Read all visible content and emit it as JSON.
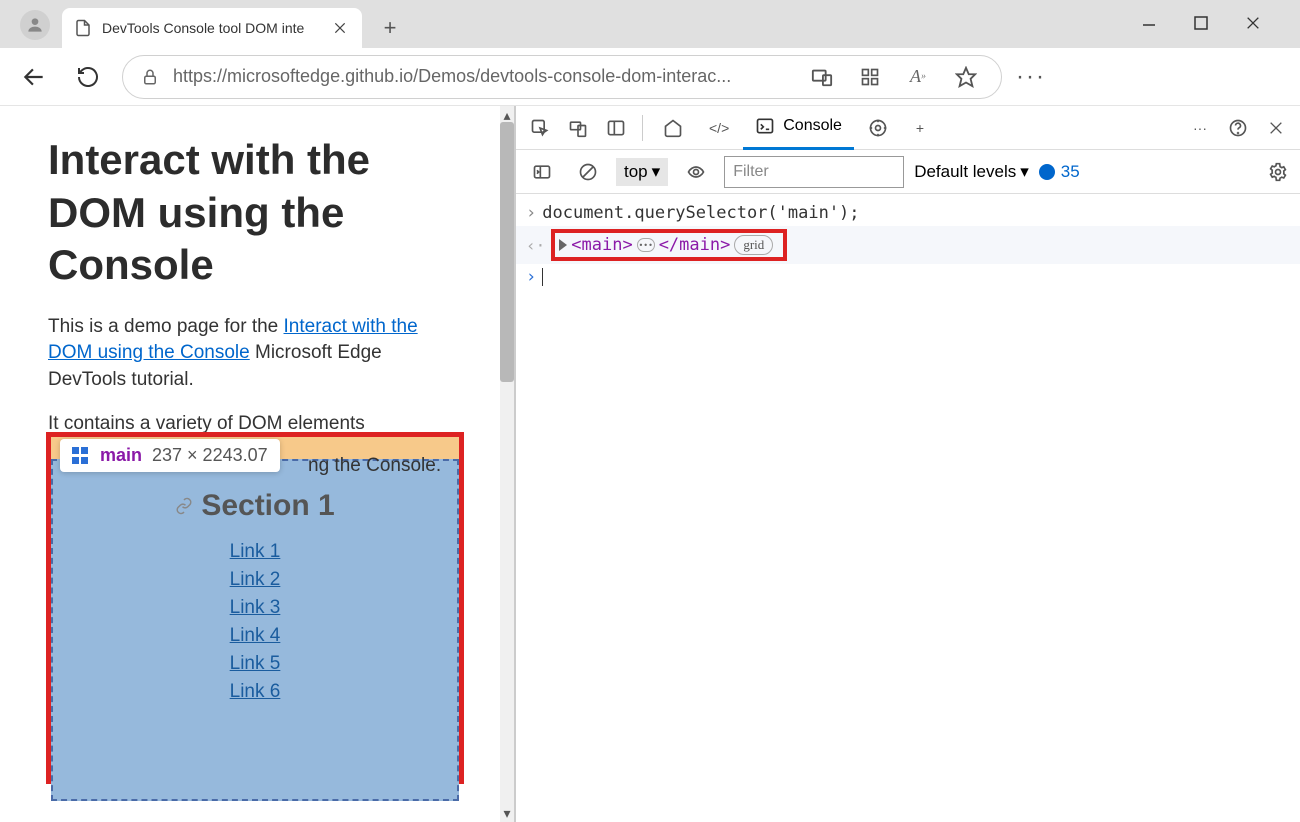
{
  "browser": {
    "tab_title": "DevTools Console tool DOM inte",
    "url": "https://microsoftedge.github.io/Demos/devtools-console-dom-interac..."
  },
  "page": {
    "heading": "Interact with the DOM using the Console",
    "intro_before": "This is a demo page for the ",
    "intro_link": "Interact with the DOM using the Console",
    "intro_after": " Microsoft Edge DevTools tutorial.",
    "para2_a": "It contains a variety of DOM elements",
    "para2_c": "ng the Console.",
    "tooltip": {
      "name": "main",
      "dim": "237 × 2243.07"
    },
    "section_title": "Section 1",
    "links": [
      "Link 1",
      "Link 2",
      "Link 3",
      "Link 4",
      "Link 5",
      "Link 6"
    ]
  },
  "devtools": {
    "tab_console": "Console",
    "context": "top",
    "filter_placeholder": "Filter",
    "levels": "Default levels",
    "issues_count": "35",
    "input": "document.querySelector('main');",
    "output_open": "<main>",
    "output_close": "</main>",
    "output_badge": "grid"
  }
}
